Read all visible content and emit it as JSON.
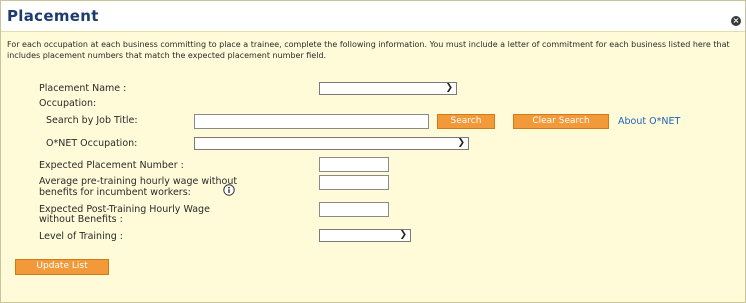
{
  "dialog": {
    "title": "Placement",
    "close_glyph": "×",
    "intro_text": "For each occupation at each business committing to place a trainee, complete the following information. You must include a letter of commitment for each business listed here that includes placement numbers that match the expected placement number field."
  },
  "form": {
    "placement_name_label": "Placement Name :",
    "placement_name_value": "",
    "occupation_label": "Occupation:",
    "search_job_title_label": "Search by Job Title:",
    "search_job_title_value": "",
    "search_button": "Search",
    "clear_search_button": "Clear Search",
    "about_onet_link": "About O*NET",
    "onet_occupation_label": "O*NET Occupation:",
    "onet_occupation_value": "",
    "expected_placement_label": "Expected Placement Number :",
    "expected_placement_value": "",
    "avg_wage_label_line1": "Average pre-training hourly wage without",
    "avg_wage_label_line2": "benefits for incumbent workers:",
    "avg_wage_value": "",
    "post_wage_label_line1": "Expected Post-Training Hourly Wage",
    "post_wage_label_line2": "without Benefits :",
    "post_wage_value": "",
    "level_training_label": "Level of Training :",
    "level_training_value": "",
    "update_list_button": "Update List"
  },
  "colors": {
    "panel_bg": "#fffbd8",
    "title_color": "#1d3c6e",
    "button_orange": "#f29a3a",
    "link_blue": "#1e63b8"
  },
  "icons": {
    "close": "close-icon",
    "info": "info-icon",
    "dropdown": "chevron-down-icon"
  }
}
